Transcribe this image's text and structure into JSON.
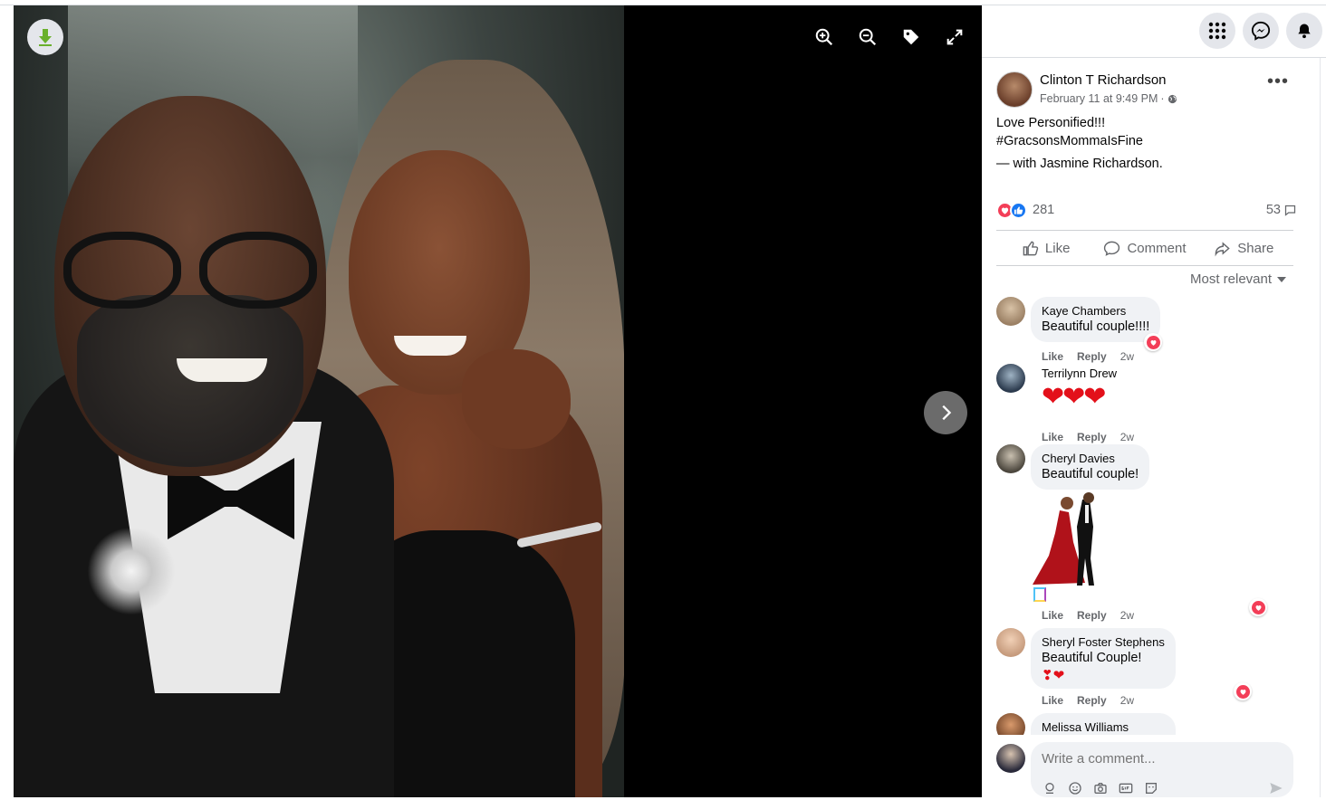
{
  "post": {
    "author": "Clinton T Richardson",
    "timestamp": "February 11 at 9:49 PM",
    "dot": "·",
    "more": "•••",
    "text_line1": "Love Personified!!!",
    "hashtag": "#GracsonsMommaIsFine",
    "with_prefix": "— with",
    "tagged": "Jasmine Richardson",
    "tagged_suffix": "."
  },
  "reactions": {
    "count": "281",
    "comments": "53"
  },
  "actions": {
    "like": "Like",
    "comment": "Comment",
    "share": "Share"
  },
  "sort_label": "Most relevant",
  "comments": [
    {
      "name": "Kaye Chambers",
      "text": "Beautiful couple!!!!",
      "like": "Like",
      "reply": "Reply",
      "age": "2w"
    },
    {
      "name": "Terrilynn Drew",
      "text": "❤❤❤",
      "like": "Like",
      "reply": "Reply",
      "age": "2w"
    },
    {
      "name": "Cheryl Davies",
      "text": "Beautiful couple!",
      "like": "Like",
      "reply": "Reply",
      "age": "2w"
    },
    {
      "name": "Sheryl Foster Stephens",
      "text": "Beautiful Couple!",
      "text2": "❣❤",
      "like": "Like",
      "reply": "Reply",
      "age": "2w"
    },
    {
      "name": "Melissa Williams"
    }
  ],
  "compose": {
    "placeholder": "Write a comment..."
  },
  "colors": {
    "love": "#f33e58",
    "like": "#1877f2",
    "download": "#6ab02c"
  },
  "icons": [
    "download-icon",
    "zoom-in-icon",
    "zoom-out-icon",
    "tag-icon",
    "fullscreen-icon",
    "chevron-right-icon",
    "menu-grid-icon",
    "messenger-icon",
    "notifications-icon"
  ]
}
